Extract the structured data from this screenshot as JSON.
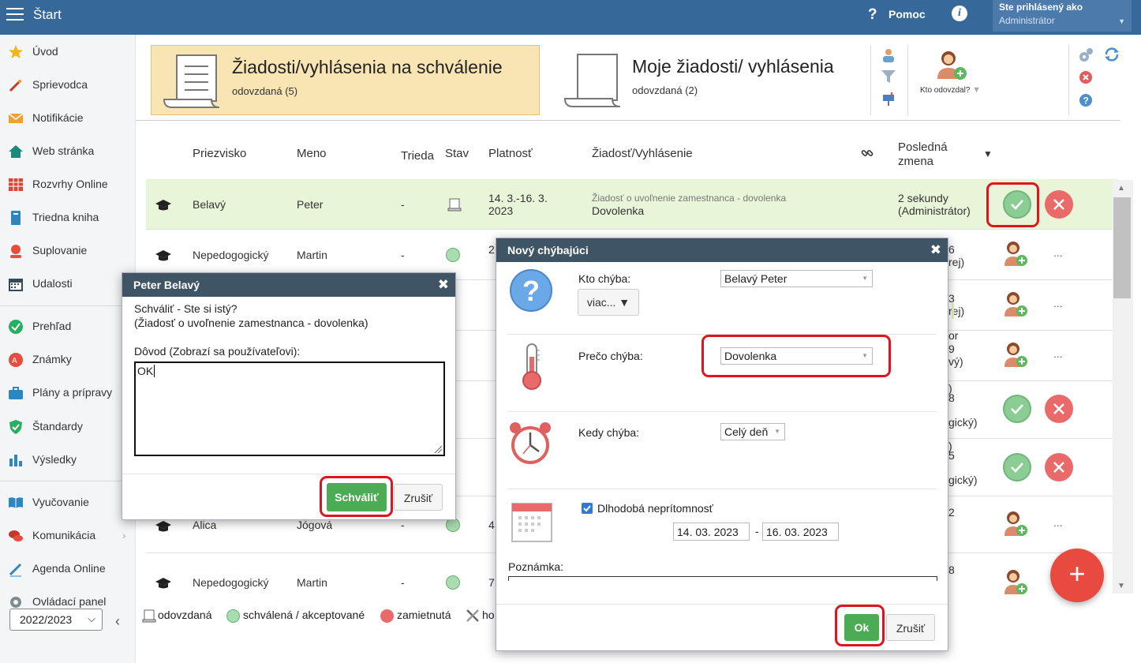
{
  "topbar": {
    "title": "Štart",
    "help_label": "Pomoc",
    "user_line1": "Ste prihlásený ako",
    "user_line2": "Administrátor"
  },
  "sidebar": {
    "items": [
      {
        "label": "Úvod",
        "icon": "star-icon"
      },
      {
        "label": "Sprievodca",
        "icon": "wand-icon"
      },
      {
        "label": "Notifikácie",
        "icon": "envelope-icon"
      },
      {
        "label": "Web stránka",
        "icon": "house-icon"
      },
      {
        "label": "Rozvrhy Online",
        "icon": "timetable-icon"
      },
      {
        "label": "Triedna kniha",
        "icon": "book-icon"
      },
      {
        "label": "Suplovanie",
        "icon": "substitute-icon"
      },
      {
        "label": "Udalosti",
        "icon": "calendar-icon"
      },
      {
        "label": "Prehľad",
        "icon": "check-circle-icon"
      },
      {
        "label": "Známky",
        "icon": "grades-icon"
      },
      {
        "label": "Plány a prípravy",
        "icon": "briefcase-icon"
      },
      {
        "label": "Štandardy",
        "icon": "shield-icon"
      },
      {
        "label": "Výsledky",
        "icon": "bar-chart-icon"
      },
      {
        "label": "Vyučovanie",
        "icon": "open-book-icon"
      },
      {
        "label": "Komunikácia",
        "icon": "chat-icon"
      },
      {
        "label": "Agenda Online",
        "icon": "pen-icon"
      },
      {
        "label": "Ovládací panel",
        "icon": "gear-icon"
      }
    ],
    "school_year": "2022/2023"
  },
  "tabs": {
    "tab1_title": "Žiadosti/vyhlásenia na schválenie",
    "tab1_sub": "odovzdaná (5)",
    "tab2_title": "Moje žiadosti/ vyhlásenia",
    "tab2_sub": "odovzdaná (2)",
    "who_submitted": "Kto odovzdal?"
  },
  "table": {
    "headers": {
      "nickname": "Priezvisko",
      "name": "Meno",
      "class": "Trieda",
      "status": "Stav",
      "validity": "Platnosť",
      "request": "Žiadosť/Vyhlásenie",
      "last_change_1": "Posledná",
      "last_change_2": "zmena",
      "sort_arrow": "▼"
    },
    "rows": [
      {
        "surname": "Belavý",
        "name": "Peter",
        "class": "-",
        "validity_1": "14. 3.-16. 3.",
        "validity_2": "2023",
        "request_type": "Žiadosť o uvoľnenie zamestnanca - dovolenka",
        "request_title": "Dovolenka",
        "last_1": "2 sekundy",
        "last_2": "(Administrátor)"
      },
      {
        "surname": "Nepedogogický",
        "name": "Martin",
        "class": "-",
        "validity_1": "2",
        "right_1": "6",
        "right_2": "rej)"
      },
      {
        "right_1": "3",
        "right_2": "rej)"
      },
      {
        "right_1": "9",
        "right_2": "vý)",
        "right_0": "or"
      },
      {
        "right_0": ")",
        "right_1": "8",
        "right_2": "gický)"
      },
      {
        "right_0": ")",
        "right_1": "5",
        "right_2": "gický)"
      },
      {
        "surname": "Alica",
        "name": "Jógová",
        "class": "-",
        "validity_1": "4",
        "right_1": "2"
      },
      {
        "surname": "Nepedogogický",
        "name": "Martin",
        "class": "-",
        "validity_1": "7",
        "right_1": "8"
      }
    ],
    "ellipsis": "..."
  },
  "legend": {
    "submitted": "odovzdaná",
    "approved": "schválená / akceptované",
    "rejected": "zamietnutá",
    "other": "ho"
  },
  "dialog_confirm": {
    "title": "Peter Belavý",
    "question": "Schváliť - Ste si istý?",
    "request": "(Žiadosť o uvoľnenie zamestnanca - dovolenka)",
    "reason_label": "Dôvod (Zobrazí sa používateľovi):",
    "reason_value": "OK",
    "approve_btn": "Schváliť",
    "cancel_btn": "Zrušiť"
  },
  "dialog_absence": {
    "title": "Nový chýbajúci",
    "who_label": "Kto chýba:",
    "who_value": "Belavý Peter",
    "more_btn": "viac... ▼",
    "why_label": "Prečo chýba:",
    "why_value": "Dovolenka",
    "when_label": "Kedy chýba:",
    "when_value": "Celý deň",
    "long_term_label": "Dlhodobá neprítomnosť",
    "date_from": "14. 03. 2023",
    "date_sep": "-",
    "date_to": "16. 03. 2023",
    "note_label": "Poznámka:",
    "ok_btn": "Ok",
    "cancel_btn": "Zrušiť"
  },
  "colors": {
    "topbar": "#37689a",
    "tab_active": "#f8e5b3",
    "row_highlight": "#e9f5d8",
    "approve_green": "#4cab55",
    "reject_red": "#ea6a6a",
    "highlight_red": "#e0141e",
    "fab": "#e84a3f"
  }
}
